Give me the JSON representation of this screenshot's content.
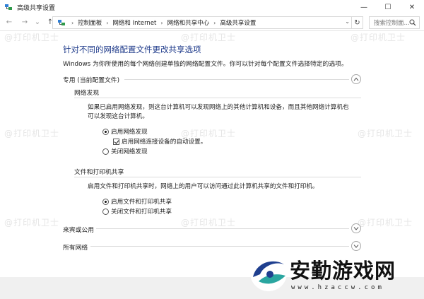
{
  "window": {
    "title": "高级共享设置",
    "controls": {
      "minimize": "—",
      "maximize": "☐",
      "close": "✕"
    }
  },
  "nav": {
    "back": "←",
    "forward": "→",
    "recent": "⌄",
    "up": "↑",
    "breadcrumbs": [
      "控制面板",
      "网络和 Internet",
      "网络和共享中心",
      "高级共享设置"
    ],
    "separator": "›",
    "dropdown": "⌄",
    "refresh": "↻",
    "search_placeholder": "搜索控制面..."
  },
  "main": {
    "title": "针对不同的网络配置文件更改共享选项",
    "description": "Windows 为你所使用的每个网络创建单独的网络配置文件。你可以针对每个配置文件选择特定的选项。",
    "private_profile": {
      "header": "专用 (当前配置文件)",
      "network_discovery": {
        "title": "网络发现",
        "desc_line1": "如果已启用网络发现，则这台计算机可以发现网络上的其他计算机和设备，而且其他网络计算机也",
        "desc_line2": "可以发现这台计算机。",
        "on_label": "启用网络发现",
        "auto_setup_label": "启用网络连接设备的自动设置。",
        "off_label": "关闭网络发现",
        "selected": "on",
        "auto_setup_checked": true
      },
      "file_printer_sharing": {
        "title": "文件和打印机共享",
        "desc": "启用文件和打印机共享时，网络上的用户可以访问通过此计算机共享的文件和打印机。",
        "on_label": "启用文件和打印机共享",
        "off_label": "关闭文件和打印机共享",
        "selected": "on"
      }
    },
    "guest_profile": {
      "header": "来宾或公用"
    },
    "all_networks": {
      "header": "所有网络"
    }
  },
  "watermark": "@打印机卫士",
  "logo": {
    "brand": "安勤游戏网",
    "url": "www.hzaccw.com"
  },
  "colors": {
    "title_blue": "#1e3a8a",
    "watermark": "#e6e6e6",
    "footer": "#f0f0f0"
  }
}
